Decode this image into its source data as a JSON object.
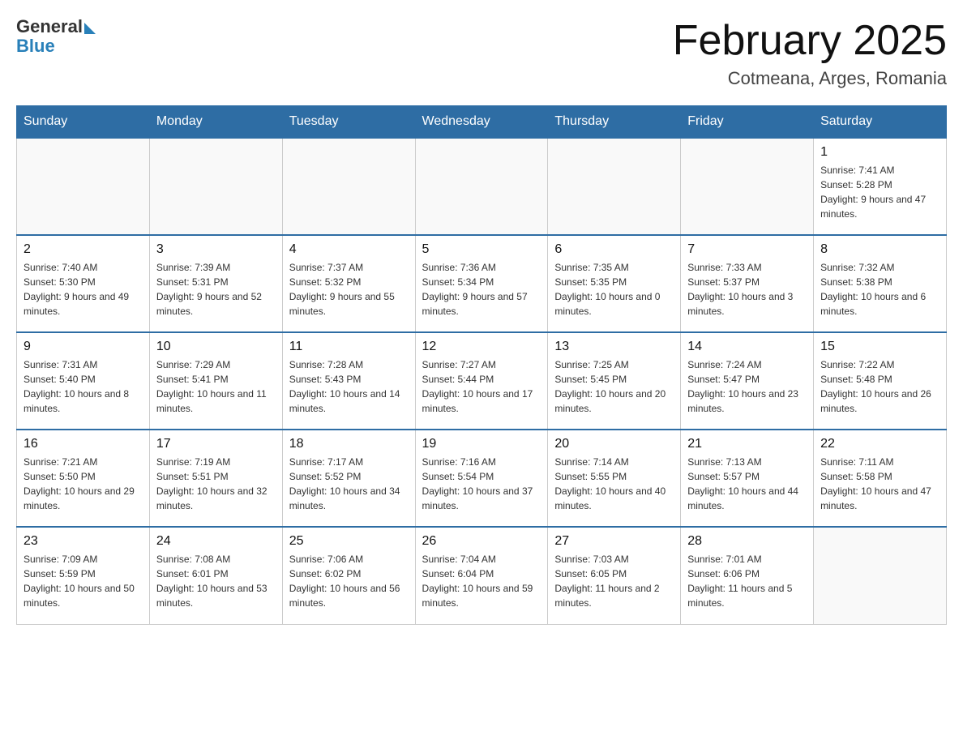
{
  "header": {
    "logo_general": "General",
    "logo_blue": "Blue",
    "title": "February 2025",
    "location": "Cotmeana, Arges, Romania"
  },
  "weekdays": [
    "Sunday",
    "Monday",
    "Tuesday",
    "Wednesday",
    "Thursday",
    "Friday",
    "Saturday"
  ],
  "weeks": [
    [
      {
        "day": "",
        "sunrise": "",
        "sunset": "",
        "daylight": ""
      },
      {
        "day": "",
        "sunrise": "",
        "sunset": "",
        "daylight": ""
      },
      {
        "day": "",
        "sunrise": "",
        "sunset": "",
        "daylight": ""
      },
      {
        "day": "",
        "sunrise": "",
        "sunset": "",
        "daylight": ""
      },
      {
        "day": "",
        "sunrise": "",
        "sunset": "",
        "daylight": ""
      },
      {
        "day": "",
        "sunrise": "",
        "sunset": "",
        "daylight": ""
      },
      {
        "day": "1",
        "sunrise": "Sunrise: 7:41 AM",
        "sunset": "Sunset: 5:28 PM",
        "daylight": "Daylight: 9 hours and 47 minutes."
      }
    ],
    [
      {
        "day": "2",
        "sunrise": "Sunrise: 7:40 AM",
        "sunset": "Sunset: 5:30 PM",
        "daylight": "Daylight: 9 hours and 49 minutes."
      },
      {
        "day": "3",
        "sunrise": "Sunrise: 7:39 AM",
        "sunset": "Sunset: 5:31 PM",
        "daylight": "Daylight: 9 hours and 52 minutes."
      },
      {
        "day": "4",
        "sunrise": "Sunrise: 7:37 AM",
        "sunset": "Sunset: 5:32 PM",
        "daylight": "Daylight: 9 hours and 55 minutes."
      },
      {
        "day": "5",
        "sunrise": "Sunrise: 7:36 AM",
        "sunset": "Sunset: 5:34 PM",
        "daylight": "Daylight: 9 hours and 57 minutes."
      },
      {
        "day": "6",
        "sunrise": "Sunrise: 7:35 AM",
        "sunset": "Sunset: 5:35 PM",
        "daylight": "Daylight: 10 hours and 0 minutes."
      },
      {
        "day": "7",
        "sunrise": "Sunrise: 7:33 AM",
        "sunset": "Sunset: 5:37 PM",
        "daylight": "Daylight: 10 hours and 3 minutes."
      },
      {
        "day": "8",
        "sunrise": "Sunrise: 7:32 AM",
        "sunset": "Sunset: 5:38 PM",
        "daylight": "Daylight: 10 hours and 6 minutes."
      }
    ],
    [
      {
        "day": "9",
        "sunrise": "Sunrise: 7:31 AM",
        "sunset": "Sunset: 5:40 PM",
        "daylight": "Daylight: 10 hours and 8 minutes."
      },
      {
        "day": "10",
        "sunrise": "Sunrise: 7:29 AM",
        "sunset": "Sunset: 5:41 PM",
        "daylight": "Daylight: 10 hours and 11 minutes."
      },
      {
        "day": "11",
        "sunrise": "Sunrise: 7:28 AM",
        "sunset": "Sunset: 5:43 PM",
        "daylight": "Daylight: 10 hours and 14 minutes."
      },
      {
        "day": "12",
        "sunrise": "Sunrise: 7:27 AM",
        "sunset": "Sunset: 5:44 PM",
        "daylight": "Daylight: 10 hours and 17 minutes."
      },
      {
        "day": "13",
        "sunrise": "Sunrise: 7:25 AM",
        "sunset": "Sunset: 5:45 PM",
        "daylight": "Daylight: 10 hours and 20 minutes."
      },
      {
        "day": "14",
        "sunrise": "Sunrise: 7:24 AM",
        "sunset": "Sunset: 5:47 PM",
        "daylight": "Daylight: 10 hours and 23 minutes."
      },
      {
        "day": "15",
        "sunrise": "Sunrise: 7:22 AM",
        "sunset": "Sunset: 5:48 PM",
        "daylight": "Daylight: 10 hours and 26 minutes."
      }
    ],
    [
      {
        "day": "16",
        "sunrise": "Sunrise: 7:21 AM",
        "sunset": "Sunset: 5:50 PM",
        "daylight": "Daylight: 10 hours and 29 minutes."
      },
      {
        "day": "17",
        "sunrise": "Sunrise: 7:19 AM",
        "sunset": "Sunset: 5:51 PM",
        "daylight": "Daylight: 10 hours and 32 minutes."
      },
      {
        "day": "18",
        "sunrise": "Sunrise: 7:17 AM",
        "sunset": "Sunset: 5:52 PM",
        "daylight": "Daylight: 10 hours and 34 minutes."
      },
      {
        "day": "19",
        "sunrise": "Sunrise: 7:16 AM",
        "sunset": "Sunset: 5:54 PM",
        "daylight": "Daylight: 10 hours and 37 minutes."
      },
      {
        "day": "20",
        "sunrise": "Sunrise: 7:14 AM",
        "sunset": "Sunset: 5:55 PM",
        "daylight": "Daylight: 10 hours and 40 minutes."
      },
      {
        "day": "21",
        "sunrise": "Sunrise: 7:13 AM",
        "sunset": "Sunset: 5:57 PM",
        "daylight": "Daylight: 10 hours and 44 minutes."
      },
      {
        "day": "22",
        "sunrise": "Sunrise: 7:11 AM",
        "sunset": "Sunset: 5:58 PM",
        "daylight": "Daylight: 10 hours and 47 minutes."
      }
    ],
    [
      {
        "day": "23",
        "sunrise": "Sunrise: 7:09 AM",
        "sunset": "Sunset: 5:59 PM",
        "daylight": "Daylight: 10 hours and 50 minutes."
      },
      {
        "day": "24",
        "sunrise": "Sunrise: 7:08 AM",
        "sunset": "Sunset: 6:01 PM",
        "daylight": "Daylight: 10 hours and 53 minutes."
      },
      {
        "day": "25",
        "sunrise": "Sunrise: 7:06 AM",
        "sunset": "Sunset: 6:02 PM",
        "daylight": "Daylight: 10 hours and 56 minutes."
      },
      {
        "day": "26",
        "sunrise": "Sunrise: 7:04 AM",
        "sunset": "Sunset: 6:04 PM",
        "daylight": "Daylight: 10 hours and 59 minutes."
      },
      {
        "day": "27",
        "sunrise": "Sunrise: 7:03 AM",
        "sunset": "Sunset: 6:05 PM",
        "daylight": "Daylight: 11 hours and 2 minutes."
      },
      {
        "day": "28",
        "sunrise": "Sunrise: 7:01 AM",
        "sunset": "Sunset: 6:06 PM",
        "daylight": "Daylight: 11 hours and 5 minutes."
      },
      {
        "day": "",
        "sunrise": "",
        "sunset": "",
        "daylight": ""
      }
    ]
  ]
}
